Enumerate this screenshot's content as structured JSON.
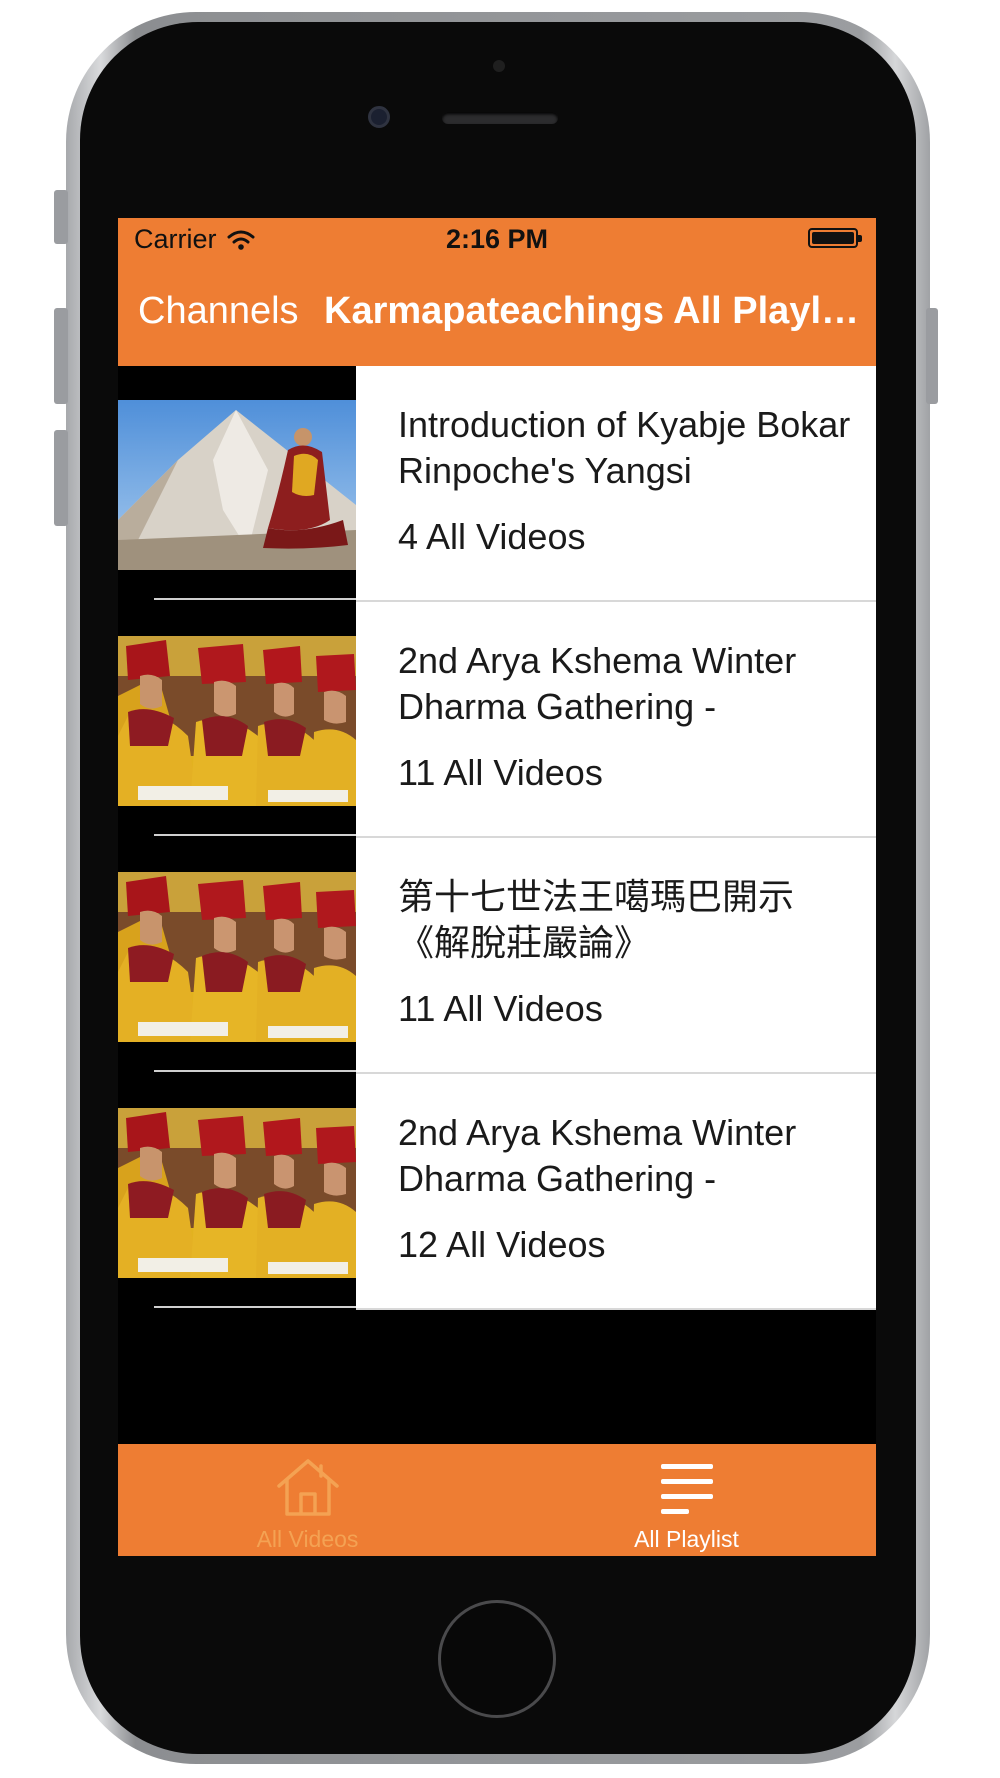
{
  "status_bar": {
    "carrier": "Carrier",
    "time": "2:16 PM",
    "wifi_icon": "wifi-icon",
    "battery_icon": "battery-icon"
  },
  "nav_bar": {
    "back_label": "Channels",
    "title": "Karmapateachings All Playlist",
    "accent_color": "#ee7d33"
  },
  "playlists": [
    {
      "title": "Introduction of Kyabje Bokar Rinpoche's Yangsi",
      "count": "4 All Videos",
      "thumbnail": "monk-mountain-photo"
    },
    {
      "title": "2nd Arya Kshema Winter Dharma Gathering -",
      "count": "11 All Videos",
      "thumbnail": "nuns-gathering-photo"
    },
    {
      "title": "第十七世法王噶瑪巴開示《解脫莊嚴論》",
      "count": "11 All Videos",
      "thumbnail": "nuns-gathering-photo"
    },
    {
      "title": "2nd Arya Kshema Winter Dharma Gathering -",
      "count": "12 All Videos",
      "thumbnail": "nuns-gathering-photo"
    }
  ],
  "tab_bar": {
    "tabs": [
      {
        "label": "All Videos",
        "icon": "home-icon",
        "active": false
      },
      {
        "label": "All Playlist",
        "icon": "list-icon",
        "active": true
      }
    ]
  }
}
